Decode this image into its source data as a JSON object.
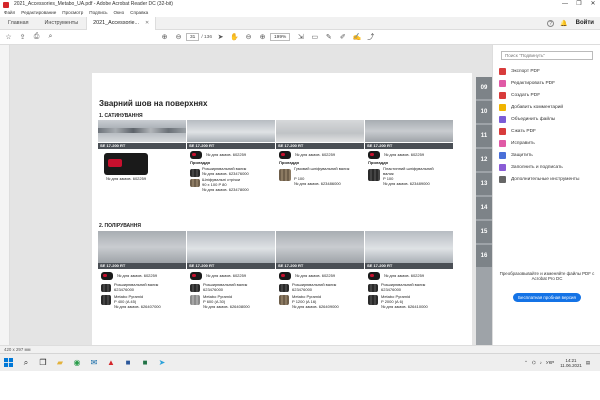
{
  "window": {
    "title": "2021_Accessories_Metabo_UA.pdf - Adobe Acrobat Reader DC (32-bit)",
    "controls": [
      "—",
      "❐",
      "✕"
    ]
  },
  "menu": [
    "Файл",
    "Редактирование",
    "Просмотр",
    "Подпись",
    "Окно",
    "Справка"
  ],
  "tabs": {
    "home": "Главная",
    "tools": "Инструменты",
    "doc": "2021_Accessorie...",
    "help": "?",
    "login": "Войти"
  },
  "toolbar": {
    "page_current": "31",
    "page_total": "/ 136",
    "zoom": "199%"
  },
  "document": {
    "heading": "Зварний шов на поверхнях",
    "section1": "1. САТИНУВАННЯ",
    "section2": "2. ПОЛІРУВАННЯ",
    "section1_cells": [
      {
        "model": "SE 17-200 RT",
        "order": "№ для замов. 602259"
      },
      {
        "model": "SE 17-200 RT",
        "order": "№ для замов. 602259",
        "head": "Приладдя",
        "item1": "Розширювальний валик",
        "item1_order": "№ для замов. 623476000",
        "item2": "Шліфувальні стрічки",
        "item2_spec": "90 x 100 P 80",
        "item2_order": "№ для замов. 623478000"
      },
      {
        "model": "SE 17-200 RT",
        "order": "№ для замов. 602259",
        "head": "Приладдя",
        "item1": "Гумовий шліфувальний валик",
        "item1_spec": "P 100",
        "item1_order": "№ для замов. 623486000"
      },
      {
        "model": "SE 17-200 RT",
        "order": "№ для замов. 602259",
        "head": "Приладдя",
        "item1": "Пластинний шліфувальний валик",
        "item1_spec": "P 100",
        "item1_order": "№ для замов. 623489000"
      }
    ],
    "section2_cells": [
      {
        "model": "SE 17-200 RT",
        "order": "№ для замов. 602259",
        "item1": "Розширювальний валик",
        "item1_order": "623476000",
        "item2": "Metabo Pyramid",
        "item2_spec": "P 400 (A 45)",
        "item2_order": "№ для замов. 626407000"
      },
      {
        "model": "SE 17-200 RT",
        "order": "№ для замов. 602259",
        "item1": "Розширювальний валик",
        "item1_order": "623476000",
        "item2": "Metabo Pyramid",
        "item2_spec": "P 600 (A 30)",
        "item2_order": "№ для замов. 626408000"
      },
      {
        "model": "SE 17-200 RT",
        "order": "№ для замов. 602259",
        "item1": "Розширювальний валик",
        "item1_order": "623476000",
        "item2": "Metabo Pyramid",
        "item2_spec": "P 1200 (A 16)",
        "item2_order": "№ для замов. 626409000"
      },
      {
        "model": "SE 17-200 RT",
        "order": "№ для замов. 602259",
        "item1": "Розширювальний валик",
        "item1_order": "623476000",
        "item2": "Metabo Pyramid",
        "item2_spec": "P 2000 (A 6)",
        "item2_order": "№ для замов. 626410000"
      }
    ],
    "page_tabs": [
      "09",
      "10",
      "11",
      "12",
      "13",
      "14",
      "15",
      "16"
    ]
  },
  "right_panel": {
    "search_placeholder": "Поиск \"Подвинуть\"",
    "tools": [
      {
        "label": "Экспорт PDF",
        "color": "#d83b3b"
      },
      {
        "label": "Редактировать PDF",
        "color": "#e05aa6"
      },
      {
        "label": "Создать PDF",
        "color": "#d83b3b"
      },
      {
        "label": "Добавить комментарий",
        "color": "#f0b400"
      },
      {
        "label": "Объединить файлы",
        "color": "#7b5cd6"
      },
      {
        "label": "Сжать PDF",
        "color": "#d83b3b"
      },
      {
        "label": "Исправить",
        "color": "#e05aa6"
      },
      {
        "label": "Защитить",
        "color": "#4a6fd8"
      },
      {
        "label": "Заполнить и подписать",
        "color": "#8a5cd6"
      },
      {
        "label": "Дополнительные инструменты",
        "color": "#666666"
      }
    ],
    "promo_text": "Преобразовывайте и изменяйте файлы PDF с Acrobat Pro DC",
    "promo_button": "Бесплатная пробная версия"
  },
  "statusbar": {
    "size": "420 x 297 мм"
  },
  "taskbar": {
    "lang": "УКР",
    "time": "14:21",
    "date": "11.06.2021"
  }
}
